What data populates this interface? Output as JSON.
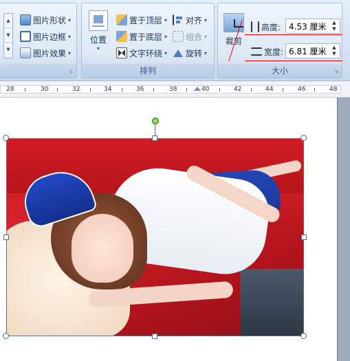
{
  "ribbon": {
    "picture_styles": {
      "shape_label": "图片形状",
      "border_label": "图片边框",
      "effects_label": "图片效果"
    },
    "arrange": {
      "position_label": "位置",
      "bring_front_label": "置于顶层",
      "send_back_label": "置于底层",
      "text_wrap_label": "文字环绕",
      "align_label": "对齐",
      "group_label": "组合",
      "rotate_label": "旋转",
      "group_title": "排列"
    },
    "size": {
      "crop_label": "裁剪",
      "height_label": "高度:",
      "height_value": "4.53 厘米",
      "width_label": "宽度:",
      "width_value": "6.81 厘米",
      "group_title": "大小"
    }
  },
  "ruler": {
    "labels": [
      "28",
      "30",
      "32",
      "34",
      "36",
      "38",
      "40",
      "42",
      "44",
      "46",
      "48"
    ]
  },
  "colors": {
    "annotation_red": "#e00000",
    "ribbon_blue": "#dfe9f5"
  }
}
